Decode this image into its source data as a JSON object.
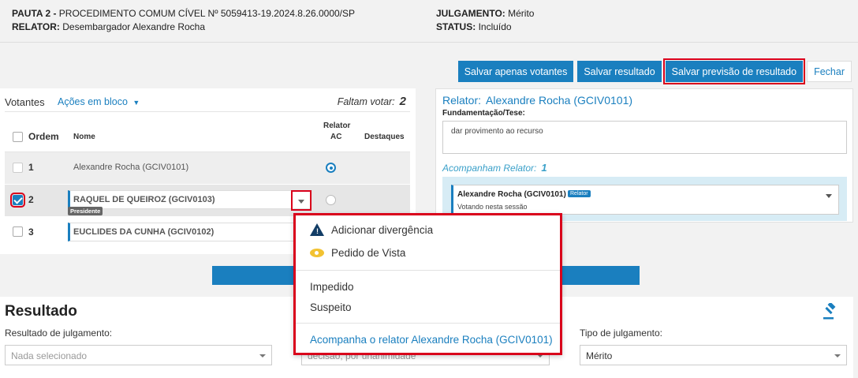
{
  "header": {
    "pauta_label": "PAUTA 2 -",
    "pauta_value": "PROCEDIMENTO COMUM CÍVEL Nº 5059413-19.2024.8.26.0000/SP",
    "relator_label": "RELATOR:",
    "relator_value": "Desembargador Alexandre Rocha",
    "julgamento_label": "JULGAMENTO:",
    "julgamento_value": "Mérito",
    "status_label": "STATUS:",
    "status_value": "Incluído"
  },
  "toolbar": {
    "salvar_votantes": "Salvar apenas votantes",
    "salvar_resultado": "Salvar resultado",
    "salvar_previsao": "Salvar previsão de resultado",
    "fechar": "Fechar"
  },
  "votantes": {
    "title": "Votantes",
    "acoes": "Ações em bloco",
    "faltam_label": "Faltam votar:",
    "faltam_value": "2",
    "columns": {
      "ordem": "Ordem",
      "nome": "Nome",
      "relator_ac_line1": "Relator",
      "relator_ac_line2": "AC",
      "destaques": "Destaques"
    },
    "rows": [
      {
        "ordem": "1",
        "nome": "Alexandre Rocha (GCIV0101)"
      },
      {
        "ordem": "2",
        "nome": "RAQUEL DE QUEIROZ (GCIV0103)",
        "badge": "Presidente"
      },
      {
        "ordem": "3",
        "nome": "EUCLIDES DA CUNHA (GCIV0102)"
      }
    ]
  },
  "relator_panel": {
    "label": "Relator:",
    "name": "Alexandre Rocha (GCIV0101)",
    "fund_label": "Fundamentação/Tese:",
    "fund_value": "dar provimento ao recurso",
    "acomp_label": "Acompanham Relator:",
    "acomp_value": "1",
    "card_name": "Alexandre Rocha (GCIV0101)",
    "card_badge": "Relator",
    "card_sub": "Votando nesta sessão"
  },
  "menu": {
    "divergencia": "Adicionar divergência",
    "vista": "Pedido de Vista",
    "impedido": "Impedido",
    "suspeito": "Suspeito",
    "acompanha": "Acompanha o relator Alexandre Rocha (GCIV0101)"
  },
  "resultado": {
    "title": "Resultado",
    "resultado_label": "Resultado de julgamento:",
    "resultado_value": "Nada selecionado",
    "middle_value": "decisão, por unanimidade",
    "tipo_label": "Tipo de julgamento:",
    "tipo_value": "Mérito"
  },
  "colors": {
    "primary": "#1a7fbf",
    "highlight": "#d9001b",
    "navy": "#123d66",
    "warning": "#f2c232"
  }
}
